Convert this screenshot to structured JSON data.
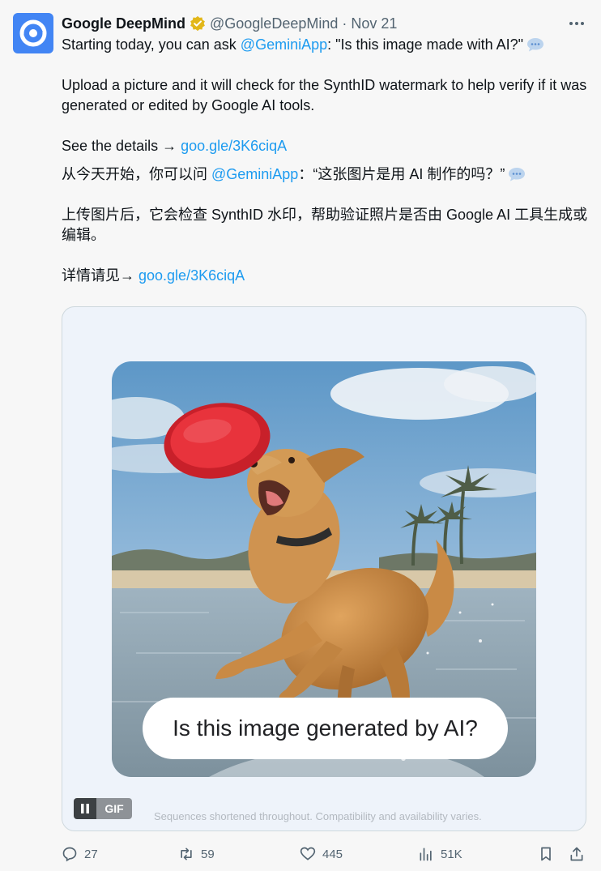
{
  "tweet": {
    "author_name": "Google DeepMind",
    "handle": "@GoogleDeepMind",
    "separator": "·",
    "date": "Nov 21",
    "line1_prefix": "Starting today, you can ask ",
    "line1_mention": "@GeminiApp",
    "line1_suffix": ": \"Is this image made with AI?\"",
    "para2": "Upload a picture and it will check for the SynthID watermark to help verify if it was generated or edited by Google AI tools.",
    "see_details": "See the details → ",
    "link": "goo.gle/3K6ciqA",
    "zh_line1_prefix": "从今天开始，你可以问 ",
    "zh_line1_mention": "@GeminiApp",
    "zh_line1_suffix": "：“这张图片是用 AI 制作的吗？”",
    "zh_para2": "上传图片后，它会检查 SynthID 水印，帮助验证照片是否由 Google AI 工具生成或编辑。",
    "zh_see_details": "详情请见→ ",
    "zh_link": "goo.gle/3K6ciqA"
  },
  "media": {
    "question": "Is this image generated by AI?",
    "gif_label": "GIF",
    "caption": "Sequences shortened throughout. Compatibility and availability varies."
  },
  "actions": {
    "replies": "27",
    "reposts": "59",
    "likes": "445",
    "views": "51K"
  },
  "colors": {
    "link": "#1d9bf0",
    "text": "#0f1419",
    "muted": "#536471",
    "verified": "#e2b719",
    "avatar": "#4285f4"
  }
}
